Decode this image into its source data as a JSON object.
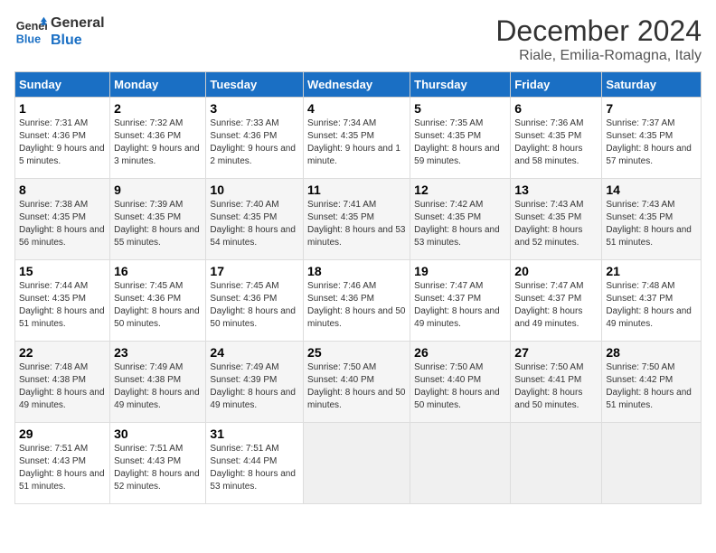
{
  "logo": {
    "line1": "General",
    "line2": "Blue"
  },
  "title": "December 2024",
  "subtitle": "Riale, Emilia-Romagna, Italy",
  "days_of_week": [
    "Sunday",
    "Monday",
    "Tuesday",
    "Wednesday",
    "Thursday",
    "Friday",
    "Saturday"
  ],
  "weeks": [
    [
      {
        "day": 1,
        "sunrise": "7:31 AM",
        "sunset": "4:36 PM",
        "daylight": "9 hours and 5 minutes."
      },
      {
        "day": 2,
        "sunrise": "7:32 AM",
        "sunset": "4:36 PM",
        "daylight": "9 hours and 3 minutes."
      },
      {
        "day": 3,
        "sunrise": "7:33 AM",
        "sunset": "4:36 PM",
        "daylight": "9 hours and 2 minutes."
      },
      {
        "day": 4,
        "sunrise": "7:34 AM",
        "sunset": "4:35 PM",
        "daylight": "9 hours and 1 minute."
      },
      {
        "day": 5,
        "sunrise": "7:35 AM",
        "sunset": "4:35 PM",
        "daylight": "8 hours and 59 minutes."
      },
      {
        "day": 6,
        "sunrise": "7:36 AM",
        "sunset": "4:35 PM",
        "daylight": "8 hours and 58 minutes."
      },
      {
        "day": 7,
        "sunrise": "7:37 AM",
        "sunset": "4:35 PM",
        "daylight": "8 hours and 57 minutes."
      }
    ],
    [
      {
        "day": 8,
        "sunrise": "7:38 AM",
        "sunset": "4:35 PM",
        "daylight": "8 hours and 56 minutes."
      },
      {
        "day": 9,
        "sunrise": "7:39 AM",
        "sunset": "4:35 PM",
        "daylight": "8 hours and 55 minutes."
      },
      {
        "day": 10,
        "sunrise": "7:40 AM",
        "sunset": "4:35 PM",
        "daylight": "8 hours and 54 minutes."
      },
      {
        "day": 11,
        "sunrise": "7:41 AM",
        "sunset": "4:35 PM",
        "daylight": "8 hours and 53 minutes."
      },
      {
        "day": 12,
        "sunrise": "7:42 AM",
        "sunset": "4:35 PM",
        "daylight": "8 hours and 53 minutes."
      },
      {
        "day": 13,
        "sunrise": "7:43 AM",
        "sunset": "4:35 PM",
        "daylight": "8 hours and 52 minutes."
      },
      {
        "day": 14,
        "sunrise": "7:43 AM",
        "sunset": "4:35 PM",
        "daylight": "8 hours and 51 minutes."
      }
    ],
    [
      {
        "day": 15,
        "sunrise": "7:44 AM",
        "sunset": "4:35 PM",
        "daylight": "8 hours and 51 minutes."
      },
      {
        "day": 16,
        "sunrise": "7:45 AM",
        "sunset": "4:36 PM",
        "daylight": "8 hours and 50 minutes."
      },
      {
        "day": 17,
        "sunrise": "7:45 AM",
        "sunset": "4:36 PM",
        "daylight": "8 hours and 50 minutes."
      },
      {
        "day": 18,
        "sunrise": "7:46 AM",
        "sunset": "4:36 PM",
        "daylight": "8 hours and 50 minutes."
      },
      {
        "day": 19,
        "sunrise": "7:47 AM",
        "sunset": "4:37 PM",
        "daylight": "8 hours and 49 minutes."
      },
      {
        "day": 20,
        "sunrise": "7:47 AM",
        "sunset": "4:37 PM",
        "daylight": "8 hours and 49 minutes."
      },
      {
        "day": 21,
        "sunrise": "7:48 AM",
        "sunset": "4:37 PM",
        "daylight": "8 hours and 49 minutes."
      }
    ],
    [
      {
        "day": 22,
        "sunrise": "7:48 AM",
        "sunset": "4:38 PM",
        "daylight": "8 hours and 49 minutes."
      },
      {
        "day": 23,
        "sunrise": "7:49 AM",
        "sunset": "4:38 PM",
        "daylight": "8 hours and 49 minutes."
      },
      {
        "day": 24,
        "sunrise": "7:49 AM",
        "sunset": "4:39 PM",
        "daylight": "8 hours and 49 minutes."
      },
      {
        "day": 25,
        "sunrise": "7:50 AM",
        "sunset": "4:40 PM",
        "daylight": "8 hours and 50 minutes."
      },
      {
        "day": 26,
        "sunrise": "7:50 AM",
        "sunset": "4:40 PM",
        "daylight": "8 hours and 50 minutes."
      },
      {
        "day": 27,
        "sunrise": "7:50 AM",
        "sunset": "4:41 PM",
        "daylight": "8 hours and 50 minutes."
      },
      {
        "day": 28,
        "sunrise": "7:50 AM",
        "sunset": "4:42 PM",
        "daylight": "8 hours and 51 minutes."
      }
    ],
    [
      {
        "day": 29,
        "sunrise": "7:51 AM",
        "sunset": "4:43 PM",
        "daylight": "8 hours and 51 minutes."
      },
      {
        "day": 30,
        "sunrise": "7:51 AM",
        "sunset": "4:43 PM",
        "daylight": "8 hours and 52 minutes."
      },
      {
        "day": 31,
        "sunrise": "7:51 AM",
        "sunset": "4:44 PM",
        "daylight": "8 hours and 53 minutes."
      },
      null,
      null,
      null,
      null
    ]
  ]
}
